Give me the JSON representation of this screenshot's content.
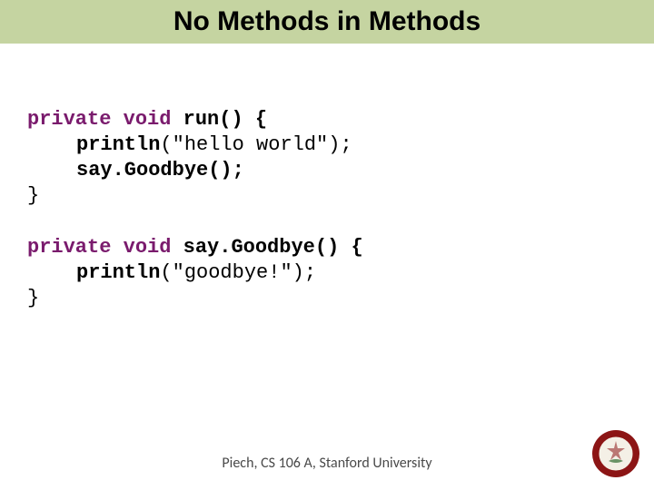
{
  "title": "No Methods in Methods",
  "code": {
    "block1": {
      "kw1": "private",
      "kw2": "void",
      "sig": "run() {",
      "l1a": "println",
      "l1b": "(\"hello world\");",
      "l2a": "say.Goodbye();",
      "close": "}"
    },
    "block2": {
      "kw1": "private",
      "kw2": "void",
      "sig": "say.Goodbye() {",
      "l1a": "println",
      "l1b": "(\"goodbye!\");",
      "close": "}"
    }
  },
  "footer": "Piech, CS 106 A, Stanford University",
  "seal": {
    "outer": "#8c1515",
    "inner": "#f4f0e6"
  }
}
